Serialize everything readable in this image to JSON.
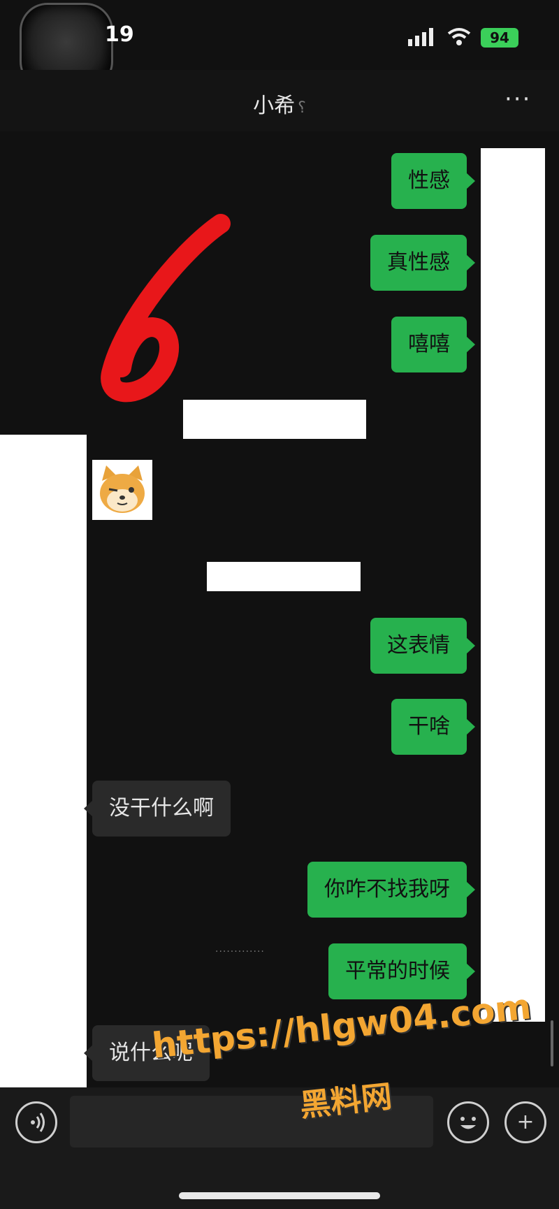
{
  "status_bar": {
    "time": "19",
    "battery": "94"
  },
  "header": {
    "title": "小希",
    "ear_icon": "ear-icon",
    "more_icon": "more-dots-icon",
    "more": "···"
  },
  "messages": [
    {
      "side": "me",
      "text": "性感"
    },
    {
      "side": "me",
      "text": "真性感"
    },
    {
      "side": "me",
      "text": "嘻嘻"
    },
    {
      "side": "them",
      "type": "sticker",
      "icon": "shiba-dog-sticker"
    },
    {
      "side": "me",
      "text": "这表情"
    },
    {
      "side": "me",
      "text": "干啥"
    },
    {
      "side": "them",
      "text": "没干什么啊"
    },
    {
      "side": "me",
      "text": "你咋不找我呀"
    },
    {
      "side": "me",
      "text": "平常的时候"
    },
    {
      "side": "them",
      "text": "说什么呢"
    }
  ],
  "annotation": {
    "text": "6",
    "color": "#e8171a"
  },
  "watermark": {
    "url": "https://hlgw04.com",
    "name": "黑料网",
    "color": "#f3a632"
  },
  "input_bar": {
    "voice_icon": "voice-icon",
    "emoji_icon": "emoji-icon",
    "plus_icon": "plus-icon",
    "plus": "+"
  },
  "colors": {
    "background": "#111111",
    "my_bubble": "#27b14e",
    "their_bubble": "#2a2a2a"
  }
}
